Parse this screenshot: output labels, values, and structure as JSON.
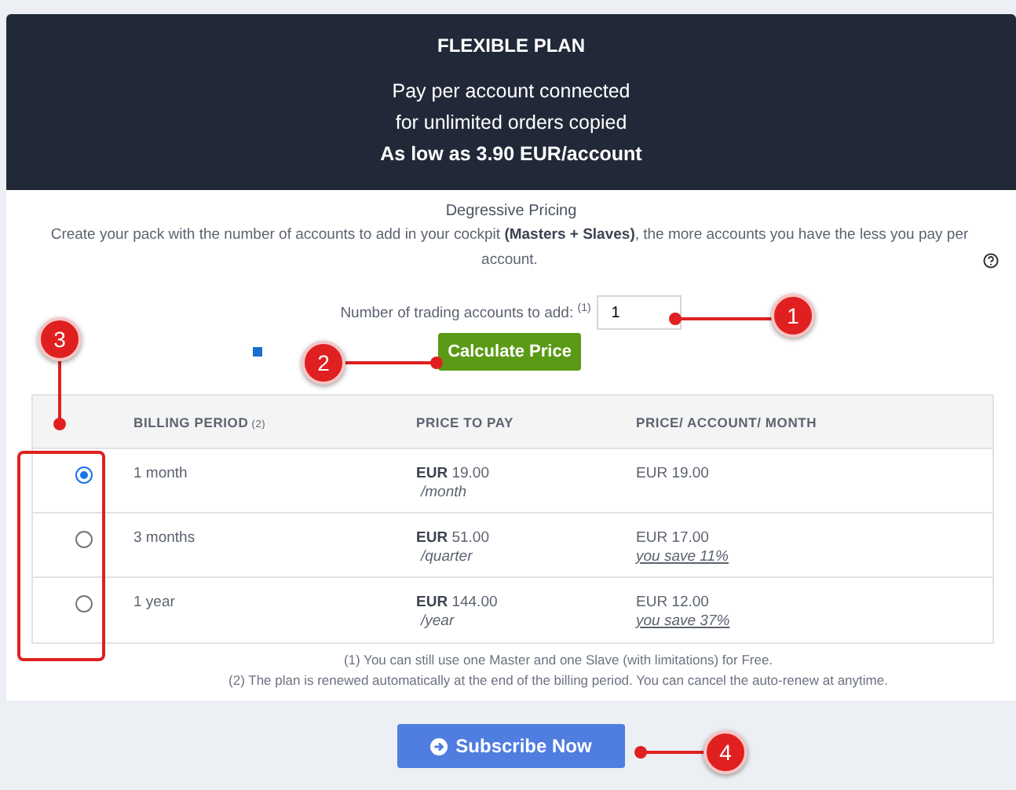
{
  "header": {
    "title": "FLEXIBLE PLAN",
    "lines": [
      "Pay per account connected",
      "for unlimited orders copied"
    ],
    "highlight": "As low as 3.90 EUR/account"
  },
  "pricing": {
    "title": "Degressive Pricing",
    "description": "Create your pack with the number of accounts to add in your cockpit **(Masters + Slaves)**, the more accounts you have the less you pay per account."
  },
  "accounts": {
    "label": "Number of trading accounts to add:",
    "note": "(1)",
    "value": "1"
  },
  "calculate_button": "Calculate Price",
  "table": {
    "columns": [
      {
        "label": "BILLING PERIOD",
        "note": "(2)"
      },
      {
        "label": "PRICE TO PAY"
      },
      {
        "label": "PRICE/ ACCOUNT/ MONTH"
      }
    ],
    "rows": [
      {
        "selected": true,
        "period": "1 month",
        "price": "**EUR** 19.00",
        "per": "/month",
        "per_account": "EUR 19.00"
      },
      {
        "selected": false,
        "period": "3 months",
        "price": "**EUR** 51.00",
        "per": "/quarter",
        "per_account": "EUR 17.00",
        "saving": "you save 11%"
      },
      {
        "selected": false,
        "period": "1 year",
        "price": "**EUR** 144.00",
        "per": "/year",
        "per_account": "EUR 12.00",
        "saving": "you save 37%"
      }
    ]
  },
  "footnotes": [
    "(1) You can still use one Master and one Slave (with limitations) for Free.",
    "(2) The plan is renewed automatically at the end of the billing period. You can cancel the auto-renew at anytime."
  ],
  "subscribe_button": "Subscribe Now",
  "annotations": [
    "1",
    "2",
    "3",
    "4"
  ]
}
